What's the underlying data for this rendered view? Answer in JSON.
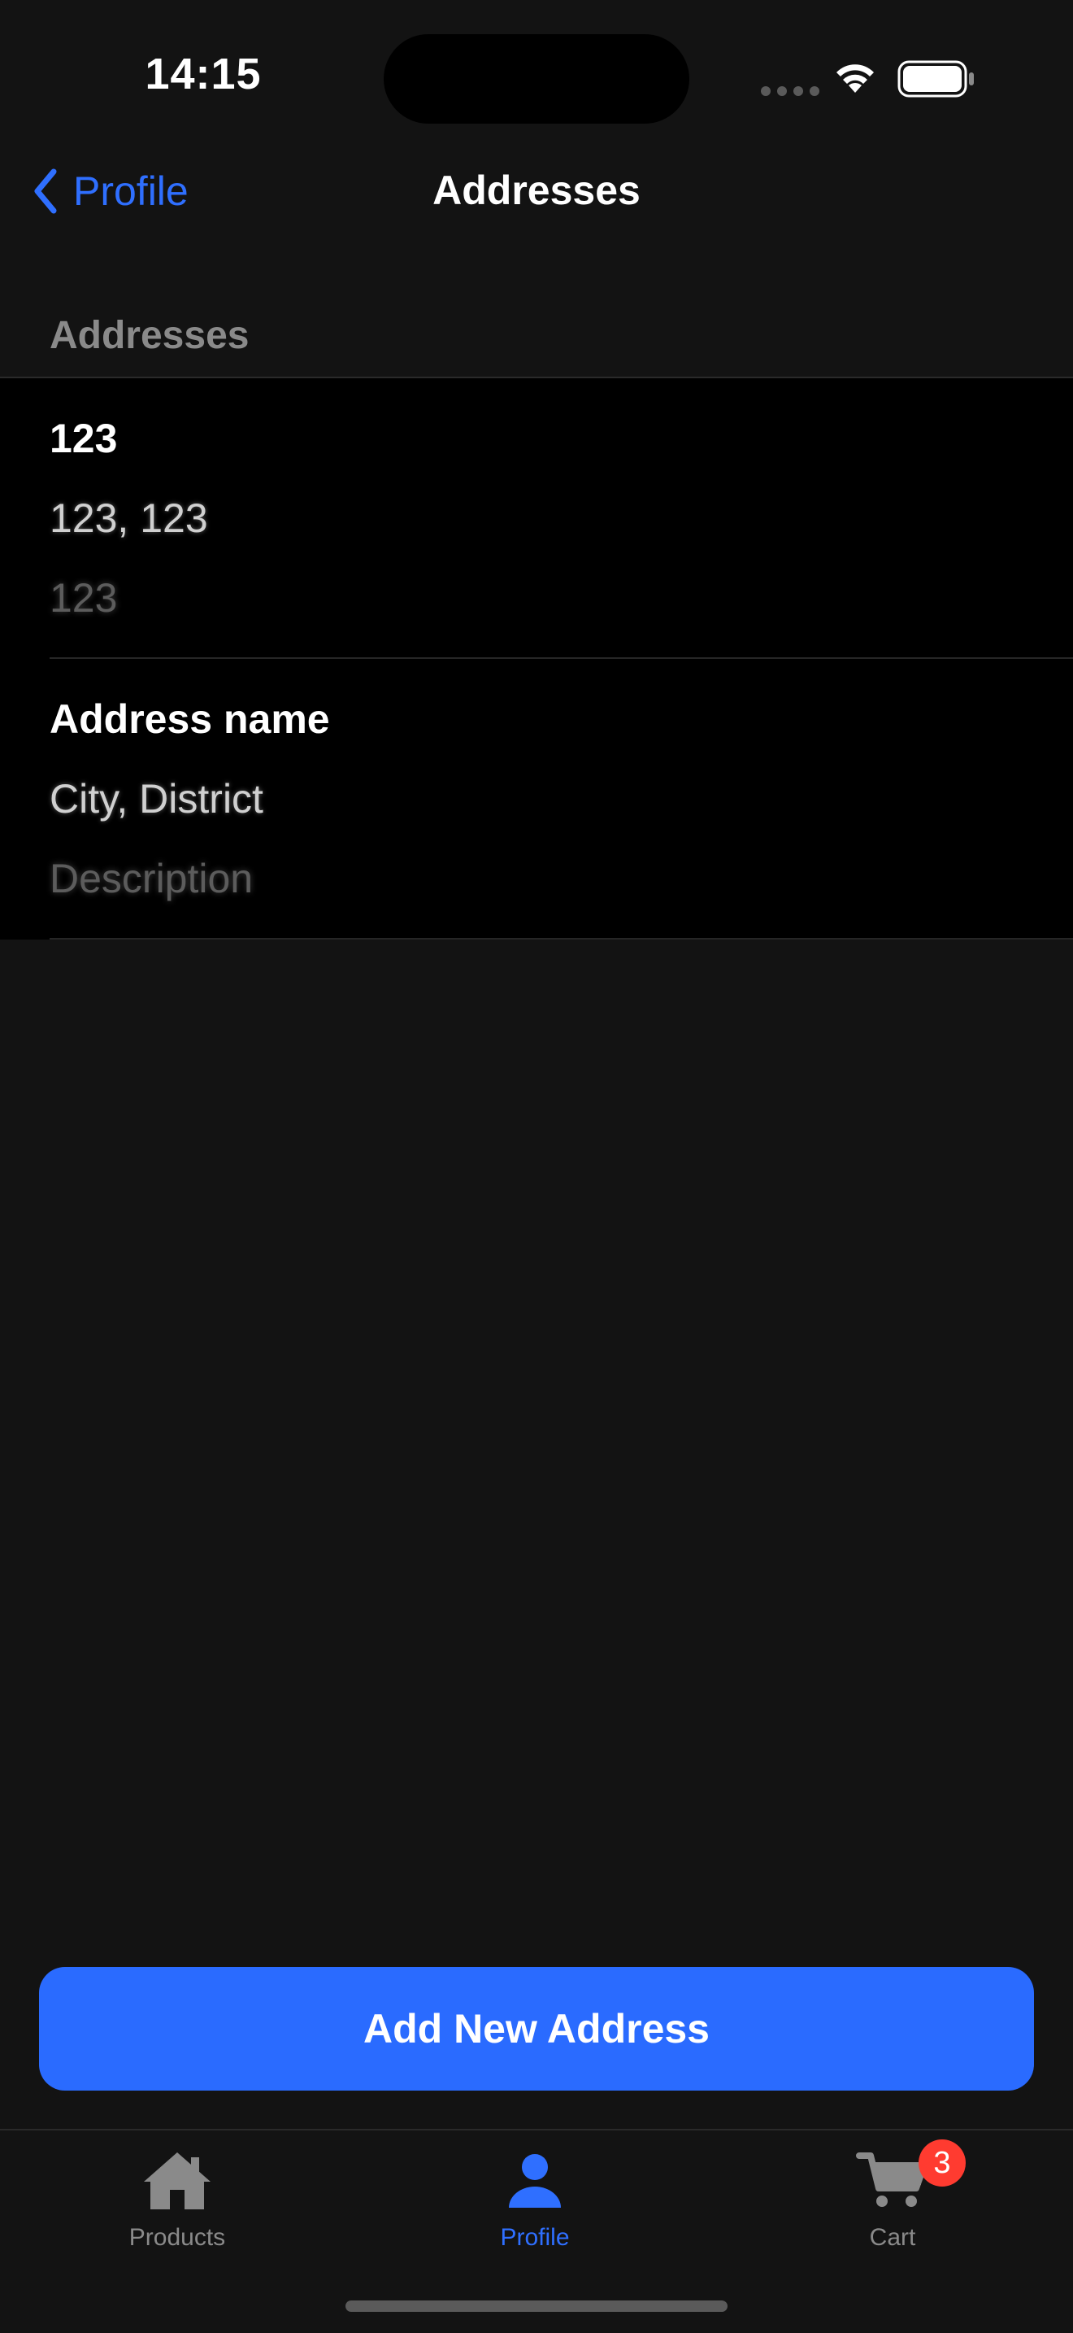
{
  "status_bar": {
    "time": "14:15",
    "icons": [
      "signal-dots-icon",
      "wifi-icon",
      "battery-icon"
    ]
  },
  "nav": {
    "back_label": "Profile",
    "title": "Addresses"
  },
  "section": {
    "header": "Addresses"
  },
  "addresses": [
    {
      "name": "123",
      "location": "123, 123",
      "description": "123"
    },
    {
      "name": "Address name",
      "location": "City, District",
      "description": "Description"
    }
  ],
  "add_button": {
    "label": "Add New Address"
  },
  "tab_bar": {
    "tabs": [
      {
        "label": "Products",
        "icon": "house-icon",
        "active": false
      },
      {
        "label": "Profile",
        "icon": "person-icon",
        "active": true
      },
      {
        "label": "Cart",
        "icon": "cart-icon",
        "active": false,
        "badge": "3"
      }
    ]
  },
  "colors": {
    "background": "#131313",
    "list_background": "#000000",
    "accent": "#2a6bff",
    "badge": "#ff3b30",
    "inactive": "#8a8a8a"
  }
}
